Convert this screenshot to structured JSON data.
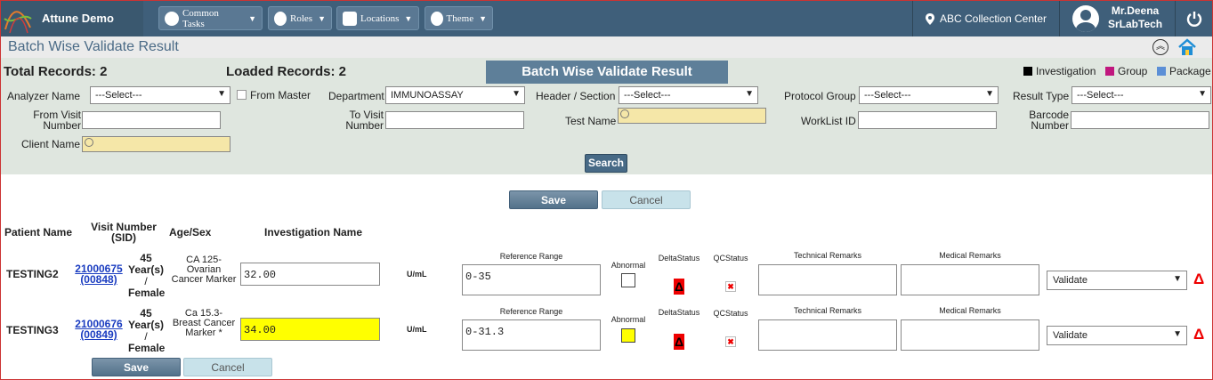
{
  "header": {
    "app_name": "Attune Demo",
    "nav": [
      {
        "label": "Common Tasks",
        "icon": "palette-icon"
      },
      {
        "label": "Roles",
        "icon": "user-circle-icon"
      },
      {
        "label": "Locations",
        "icon": "database-icon"
      },
      {
        "label": "Theme",
        "icon": "palette-icon"
      }
    ],
    "location": "ABC Collection Center",
    "user_name": "Mr.Deena",
    "user_role": "SrLabTech"
  },
  "page_title": "Batch Wise Validate Result",
  "summary": {
    "total_records": "Total Records: 2",
    "loaded_records": "Loaded Records: 2",
    "banner": "Batch Wise Validate Result"
  },
  "legend": [
    {
      "label": "Investigation",
      "color": "#000000"
    },
    {
      "label": "Group",
      "color": "#c0177e"
    },
    {
      "label": "Package",
      "color": "#5b8fd6"
    }
  ],
  "filters": {
    "analyzer_name_label": "Analyzer Name",
    "analyzer_name_value": "---Select---",
    "from_master_label": "From Master",
    "department_label": "Department",
    "department_value": "IMMUNOASSAY",
    "header_section_label": "Header / Section",
    "header_section_value": "---Select---",
    "protocol_group_label": "Protocol Group",
    "protocol_group_value": "---Select---",
    "result_type_label": "Result Type",
    "result_type_value": "---Select---",
    "from_visit_label_1": "From Visit",
    "from_visit_label_2": "Number",
    "to_visit_label_1": "To Visit",
    "to_visit_label_2": "Number",
    "test_name_label": "Test Name",
    "worklist_id_label": "WorkList ID",
    "barcode_label_1": "Barcode",
    "barcode_label_2": "Number",
    "client_name_label": "Client Name",
    "search_button": "Search"
  },
  "actions": {
    "save": "Save",
    "cancel": "Cancel"
  },
  "columns": {
    "patient_name": "Patient Name",
    "visit_number_1": "Visit Number",
    "visit_number_2": "(SID)",
    "age_sex": "Age/Sex",
    "investigation_name": "Investigation Name",
    "reference_range": "Reference Range",
    "abnormal": "Abnormal",
    "delta_status": "DeltaStatus",
    "qc_status": "QCStatus",
    "technical_remarks": "Technical Remarks",
    "medical_remarks": "Medical Remarks"
  },
  "rows": [
    {
      "patient_name": "TESTING2",
      "visit_number": "21000675",
      "sid": "(00848)",
      "age": "45",
      "age_unit": "Year(s)",
      "sep": "/",
      "sex": "Female",
      "investigation_1": "CA 125-",
      "investigation_2": "Ovarian",
      "investigation_3": "Cancer Marker",
      "value": "32.00",
      "unit": "U/mL",
      "reference_range": "0-35",
      "status": "Validate",
      "delta_symbol": "Δ",
      "qc_symbol": "✖"
    },
    {
      "patient_name": "TESTING3",
      "visit_number": "21000676",
      "sid": "(00849)",
      "age": "45",
      "age_unit": "Year(s)",
      "sep": "/",
      "sex": "Female",
      "investigation_1": "Ca 15.3-",
      "investigation_2": "Breast Cancer",
      "investigation_3": "Marker *",
      "value": "34.00",
      "unit": "U/mL",
      "reference_range": "0-31.3",
      "status": "Validate",
      "delta_symbol": "Δ",
      "qc_symbol": "✖"
    }
  ]
}
